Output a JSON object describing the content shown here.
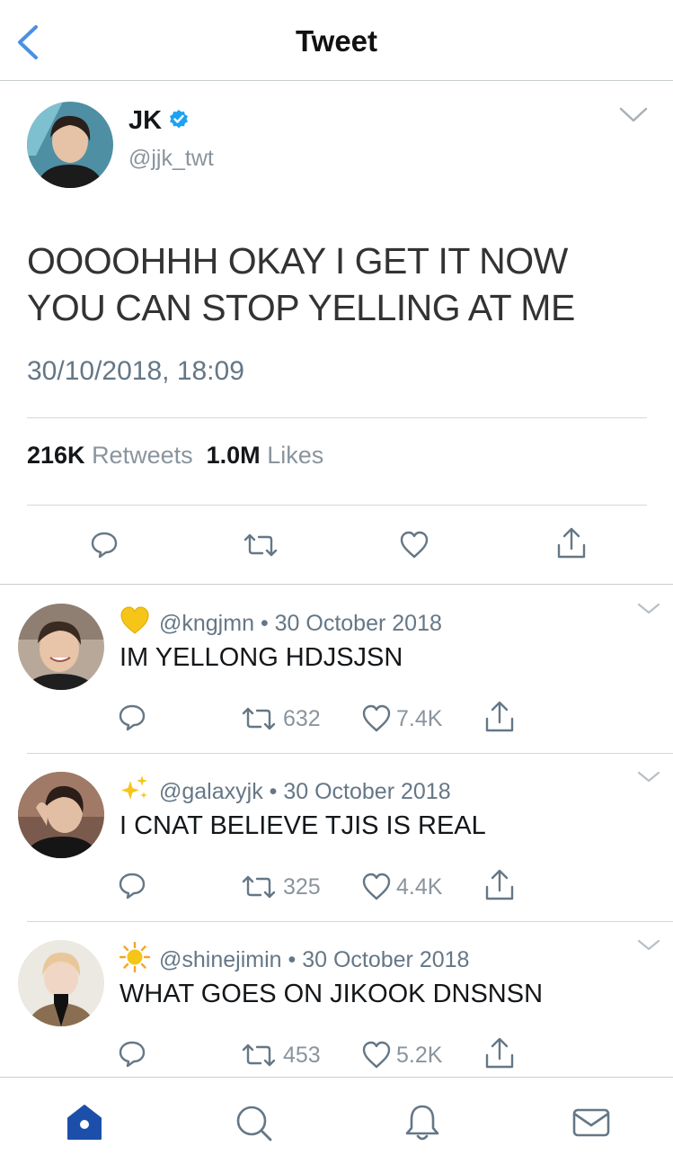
{
  "header": {
    "title": "Tweet",
    "back_icon": "chevron-left-icon"
  },
  "tweet": {
    "author_name": "JK",
    "handle": "@jjk_twt",
    "verified": true,
    "text": "OOOOHHH OKAY I GET IT NOW YOU CAN STOP YELLING AT ME",
    "timestamp": "30/10/2018, 18:09",
    "retweets_count": "216K",
    "retweets_label": "Retweets",
    "likes_count": "1.0M",
    "likes_label": "Likes"
  },
  "replies": [
    {
      "emoji": "yellow-heart-icon",
      "handle": "@kngjmn",
      "date": "• 30 October 2018",
      "text": "IM YELLONG HDJSJSN",
      "retweets": "632",
      "likes": "7.4K"
    },
    {
      "emoji": "sparkles-icon",
      "handle": "@galaxyjk",
      "date": "• 30 October 2018",
      "text": "I CNAT BELIEVE TJIS IS REAL",
      "retweets": "325",
      "likes": "4.4K"
    },
    {
      "emoji": "sun-icon",
      "handle": "@shinejimin",
      "date": "• 30 October 2018",
      "text": "WHAT GOES ON JIKOOK DNSNSN",
      "retweets": "453",
      "likes": "5.2K"
    }
  ],
  "tabs": [
    "home-icon",
    "search-icon",
    "bell-icon",
    "mail-icon"
  ],
  "colors": {
    "accent": "#1da1f2",
    "back": "#4a90e2",
    "heart": "#f5c518",
    "tab_active": "#1c4faa",
    "icon": "#657786"
  }
}
